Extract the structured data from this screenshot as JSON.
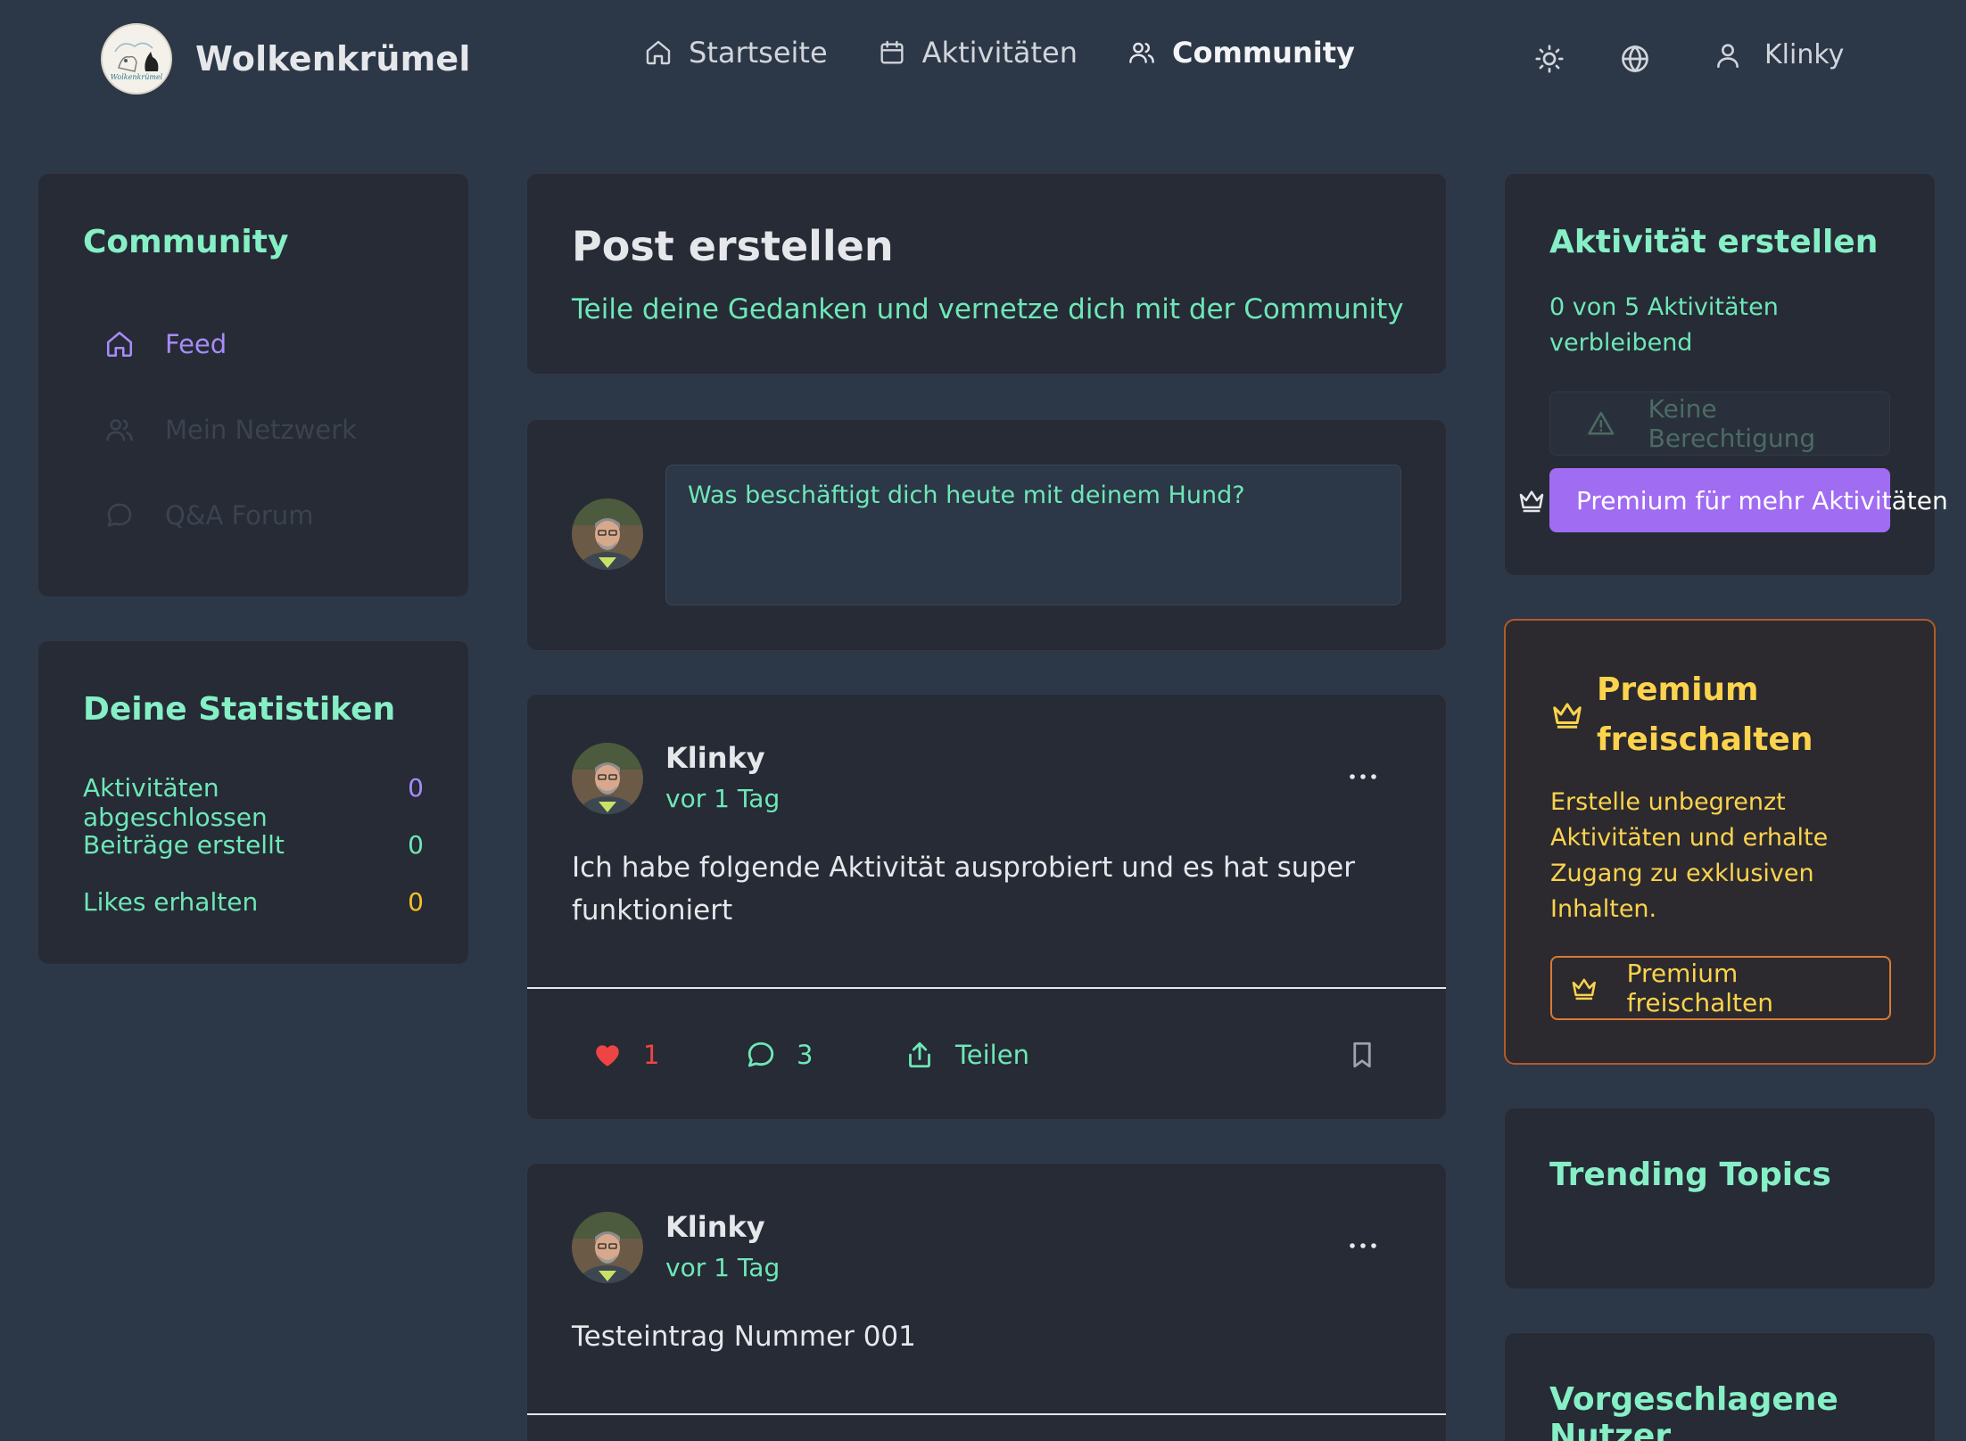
{
  "header": {
    "brand": "Wolkenkrümel",
    "logo_text": "Wolkenkrümel",
    "nav": [
      {
        "label": "Startseite",
        "icon": "home-icon"
      },
      {
        "label": "Aktivitäten",
        "icon": "calendar-icon"
      },
      {
        "label": "Community",
        "icon": "users-icon",
        "active": true
      }
    ],
    "user": "Klinky"
  },
  "sidebar": {
    "title": "Community",
    "items": [
      {
        "label": "Feed",
        "icon": "home-icon",
        "active": true
      },
      {
        "label": "Mein Netzwerk",
        "icon": "users-icon"
      },
      {
        "label": "Q&A Forum",
        "icon": "chat-bubble-icon"
      }
    ]
  },
  "stats": {
    "title": "Deine Statistiken",
    "rows": [
      {
        "label": "Aktivitäten abgeschlossen",
        "value": "0",
        "color": "#a78bfa"
      },
      {
        "label": "Beiträge erstellt",
        "value": "0",
        "color": "#6ee7b7"
      },
      {
        "label": "Likes erhalten",
        "value": "0",
        "color": "#fbbf24"
      }
    ]
  },
  "create_post": {
    "title": "Post erstellen",
    "subtitle": "Teile deine Gedanken und vernetze dich mit der Community"
  },
  "composer": {
    "placeholder": "Was beschäftigt dich heute mit deinem Hund?"
  },
  "posts": [
    {
      "author": "Klinky",
      "time": "vor 1 Tag",
      "text": "Ich habe folgende Aktivität ausprobiert und es hat super funktioniert",
      "likes": "1",
      "comments": "3",
      "share_label": "Teilen"
    },
    {
      "author": "Klinky",
      "time": "vor 1 Tag",
      "text": "Testeintrag Nummer 001"
    }
  ],
  "create_activity": {
    "title": "Aktivität erstellen",
    "remaining": "0 von 5 Aktivitäten verbleibend",
    "no_permission_label": "Keine Berechtigung",
    "premium_button": "Premium für mehr Aktivitäten"
  },
  "premium": {
    "title": "Premium freischalten",
    "text": "Erstelle unbegrenzt Aktivitäten und erhalte Zugang zu exklusiven Inhalten.",
    "button": "Premium freischalten"
  },
  "trending": {
    "title": "Trending Topics"
  },
  "suggested": {
    "title": "Vorgeschlagene Nutzer"
  },
  "colors": {
    "background": "#2c3747",
    "card": "#262b35",
    "accent_green": "#6ee7b7",
    "accent_purple": "#a78bfa",
    "premium_gold": "#fcd34d",
    "like_red": "#ef4444"
  }
}
